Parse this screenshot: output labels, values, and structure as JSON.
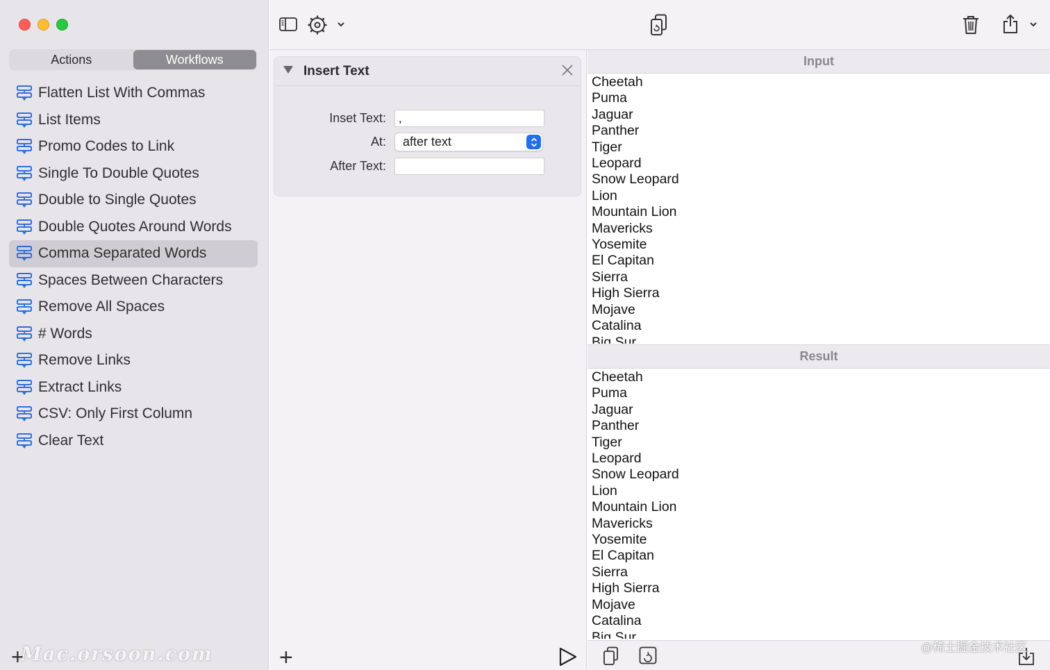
{
  "sidebar": {
    "segments": [
      {
        "label": "Actions",
        "active": false
      },
      {
        "label": "Workflows",
        "active": true
      }
    ],
    "items": [
      {
        "label": "Flatten List With Commas"
      },
      {
        "label": "List Items"
      },
      {
        "label": "Promo Codes to Link"
      },
      {
        "label": "Single To Double Quotes"
      },
      {
        "label": "Double to Single Quotes"
      },
      {
        "label": "Double Quotes Around Words"
      },
      {
        "label": "Comma Separated Words",
        "selected": true
      },
      {
        "label": "Spaces Between Characters"
      },
      {
        "label": "Remove All Spaces"
      },
      {
        "label": "# Words"
      },
      {
        "label": "Remove Links"
      },
      {
        "label": "Extract Links"
      },
      {
        "label": "CSV: Only First Column"
      },
      {
        "label": "Clear Text"
      }
    ],
    "add_label": "+",
    "watermark": "Mac.orsoon.com"
  },
  "toolbar": {
    "icons": [
      "sidebar-toggle-icon",
      "gear-icon",
      "chevron-down-icon",
      "copy-convert-icon",
      "trash-icon",
      "share-icon",
      "chevron-down-icon"
    ]
  },
  "action": {
    "title": "Insert Text",
    "fields": {
      "inset_label": "Inset Text:",
      "inset_value": ",",
      "at_label": "At:",
      "at_value": "after text",
      "after_label": "After Text:",
      "after_value": ""
    }
  },
  "editor": {
    "add_label": "+"
  },
  "input": {
    "header": "Input",
    "lines": [
      "Cheetah",
      "Puma",
      "Jaguar",
      "Panther",
      "Tiger",
      "Leopard",
      "Snow Leopard",
      "Lion",
      "Mountain Lion",
      "Mavericks",
      "Yosemite",
      "El Capitan",
      "Sierra",
      "High Sierra",
      "Mojave",
      "Catalina",
      "Big Sur"
    ]
  },
  "result": {
    "header": "Result",
    "lines": [
      "Cheetah",
      "Puma",
      "Jaguar",
      "Panther",
      "Tiger",
      "Leopard",
      "Snow Leopard",
      "Lion",
      "Mountain Lion",
      "Mavericks",
      "Yosemite",
      "El Capitan",
      "Sierra",
      "High Sierra",
      "Mojave",
      "Catalina",
      "Big Sur"
    ]
  },
  "overlay": {
    "juejin_watermark": "@稀土掘金技术社区"
  },
  "colors": {
    "accent": "#1f6ff0",
    "workflow_icon": "#2f6fdc",
    "selected_row": "#cfcdd3",
    "segment_active": "#8e8c93"
  }
}
